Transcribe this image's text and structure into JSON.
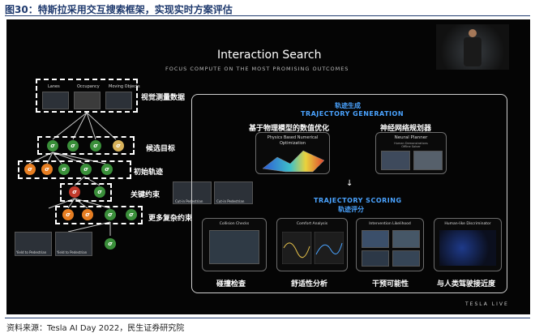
{
  "figure_title": "图30：特斯拉采用交互搜索框架，实现实时方案评估",
  "source_note": "资料来源：Tesla AI Day 2022，民生证券研究院",
  "slide": {
    "title": "Interaction Search",
    "subtitle": "FOCUS COMPUTE ON THE MOST PROMISING OUTCOMES",
    "brand": "TESLA LIVE",
    "left_tree": {
      "vision_labels": [
        "Lanes",
        "Occupancy",
        "Moving Objects"
      ],
      "levels": [
        "视觉测量数据",
        "候选目标",
        "初始轨迹",
        "关键约束",
        "更多复杂约束"
      ],
      "node_glyph": "σ"
    },
    "generation": {
      "cn_title": "轨迹生成",
      "en_title": "TRAJECTORY GENERATION",
      "physics_cn": "基于物理模型的数值优化",
      "physics_en": "Physics Based Numerical Optimization",
      "neural_cn": "神经网络规划器",
      "neural_en": "Neural Planner",
      "neural_sub1": "Human Demonstrations",
      "neural_sub2": "Offline Solver"
    },
    "arrow": "↓",
    "scoring": {
      "en_title": "TRAJECTORY SCORING",
      "cn_title": "轨迹评分",
      "cards": [
        {
          "en": "Collision Checks",
          "cn": "碰撞检查"
        },
        {
          "en": "Comfort Analysis",
          "cn": "舒适性分析"
        },
        {
          "en": "Intervention Likelihood",
          "cn": "干预可能性"
        },
        {
          "en": "Human-like Discriminator",
          "cn": "与人类驾驶接近度"
        }
      ]
    },
    "mid_thumbs": [
      "Cut-in Pedestrian",
      "Cut-in Pedestrian"
    ],
    "bottom_thumbs": [
      "Yield to Pedestrian",
      "Yield to Pedestrian"
    ]
  },
  "colors": {
    "title_blue": "#1f3a6e",
    "accent_blue": "#4aa3ff",
    "node_green": "#3a8f3a",
    "node_red": "#c0392b",
    "node_orange": "#e67e22"
  }
}
